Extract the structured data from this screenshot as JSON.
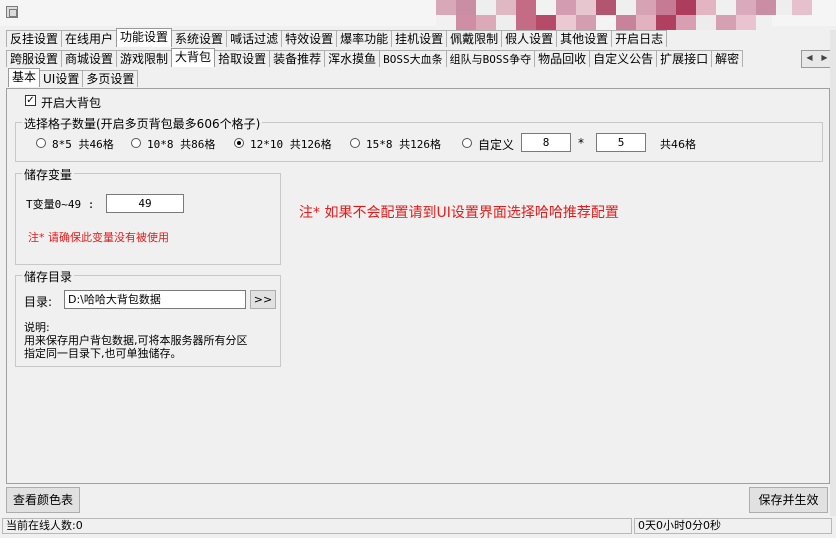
{
  "tabs_row1": [
    "反挂设置",
    "在线用户",
    "功能设置",
    "系统设置",
    "喊话过滤",
    "特效设置",
    "爆率功能",
    "挂机设置",
    "佩戴限制",
    "假人设置",
    "其他设置",
    "开启日志"
  ],
  "tabs_row2": [
    "跨服设置",
    "商城设置",
    "游戏限制",
    "大背包",
    "拾取设置",
    "装备推荐",
    "浑水摸鱼",
    "BOSS大血条",
    "组队与BOSS争夺",
    "物品回收",
    "自定义公告",
    "扩展接口",
    "解密"
  ],
  "tabs_row3": [
    "基本",
    "UI设置",
    "多页设置"
  ],
  "enable_big_bag": "开启大背包",
  "grid_group": {
    "title": "选择格子数量(开启多页背包最多606个格子)",
    "opt1": "8*5 共46格",
    "opt2": "10*8 共86格",
    "opt3": "12*10 共126格",
    "opt4": "15*8 共126格",
    "opt5": "自定义",
    "custom_a": "8",
    "times": "*",
    "custom_b": "5",
    "custom_total": "共46格"
  },
  "var_group": {
    "title": "储存变量",
    "label": "T变量0~49 :",
    "value": "49",
    "note": "注*  请确保此变量没有被使用"
  },
  "dir_group": {
    "title": "储存目录",
    "label": "目录:",
    "path": "D:\\哈哈大背包数据",
    "browse": ">>",
    "desc_title": "说明:",
    "desc_line1": "用来保存用户背包数据,可将本服务器所有分区",
    "desc_line2": "指定同一目录下,也可单独储存。"
  },
  "notice": "注* 如果不会配置请到UI设置界面选择哈哈推荐配置",
  "btn_color": "查看颜色表",
  "btn_save": "保存并生效",
  "status_online": "当前在线人数:0",
  "status_uptime": "0天0小时0分0秒",
  "colors": {
    "accent_red": "#e31b1b"
  }
}
